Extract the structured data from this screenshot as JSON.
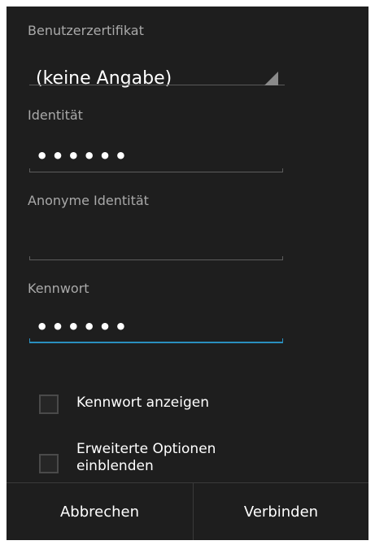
{
  "form": {
    "user_cert_label": "Benutzerzertifikat",
    "user_cert_value": "(keine Angabe)",
    "identity_label": "Identität",
    "identity_value": "••••••",
    "anon_identity_label": "Anonyme Identität",
    "anon_identity_value": "",
    "password_label": "Kennwort",
    "password_value": "••••••",
    "show_password_label": "Kennwort anzeigen",
    "show_password_checked": false,
    "advanced_options_label_line1": "Erweiterte Optionen",
    "advanced_options_label_line2": "einblenden",
    "advanced_options_checked": false
  },
  "buttons": {
    "cancel_label": "Abbrechen",
    "connect_label": "Verbinden"
  },
  "colors": {
    "background": "#1e1e1e",
    "focus_accent": "#2a8fbf",
    "label_text": "#a9a9a9"
  }
}
